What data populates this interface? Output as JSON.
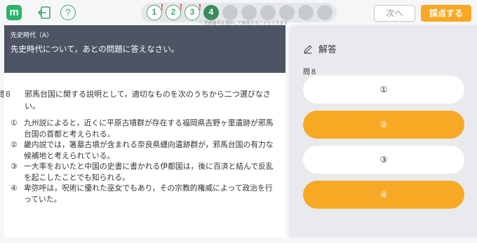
{
  "header": {
    "logo_letter": "m",
    "help_label": "?",
    "question_nav": [
      {
        "label": "1",
        "state": "done",
        "flag": "!"
      },
      {
        "label": "2",
        "state": "done",
        "flag": "!"
      },
      {
        "label": "3",
        "state": "done",
        "flag": "!"
      },
      {
        "label": "4",
        "state": "current",
        "flag": ""
      },
      {
        "label": "",
        "state": "empty"
      },
      {
        "label": "",
        "state": "empty"
      },
      {
        "label": "",
        "state": "empty"
      },
      {
        "label": "",
        "state": "empty"
      },
      {
        "label": "",
        "state": "empty"
      },
      {
        "label": "",
        "state": "empty"
      }
    ],
    "nav_note": "問題番号を選択して解答することもできます",
    "next_label": "次へ",
    "score_label": "採点する",
    "accent_color": "#f7a925",
    "brand_color": "#2fb36b"
  },
  "passage": {
    "category": "先史時代（A）",
    "intro": "先史時代について，あとの問題に答えなさい。"
  },
  "question": {
    "number": "問８",
    "text": "邪馬台国に関する説明として，適切なものを次のうちから二つ選びなさい。",
    "choices": [
      {
        "mark": "①",
        "text": "九州説によると，近くに平原古墳群が存在する福岡県吉野ヶ里遺跡が邪馬台国の首都と考えられる。"
      },
      {
        "mark": "②",
        "text": "畿内説では，箸墓古墳が含まれる奈良県纒向遺跡群が，邪馬台国の有力な候補地と考えられている。"
      },
      {
        "mark": "③",
        "text": "一大率をおいたと中国の史書に書かれる伊都国は，後に百済と結んで反乱を起こしたことでも知られる。"
      },
      {
        "mark": "④",
        "text": "卑弥呼は，呪術に優れた巫女でもあり，その宗教的権威によって政治を行っていた。"
      }
    ]
  },
  "answer": {
    "heading": "解答",
    "question_label": "問８",
    "options": [
      {
        "label": "①",
        "selected": false
      },
      {
        "label": "②",
        "selected": true
      },
      {
        "label": "③",
        "selected": false
      },
      {
        "label": "④",
        "selected": true
      }
    ]
  }
}
